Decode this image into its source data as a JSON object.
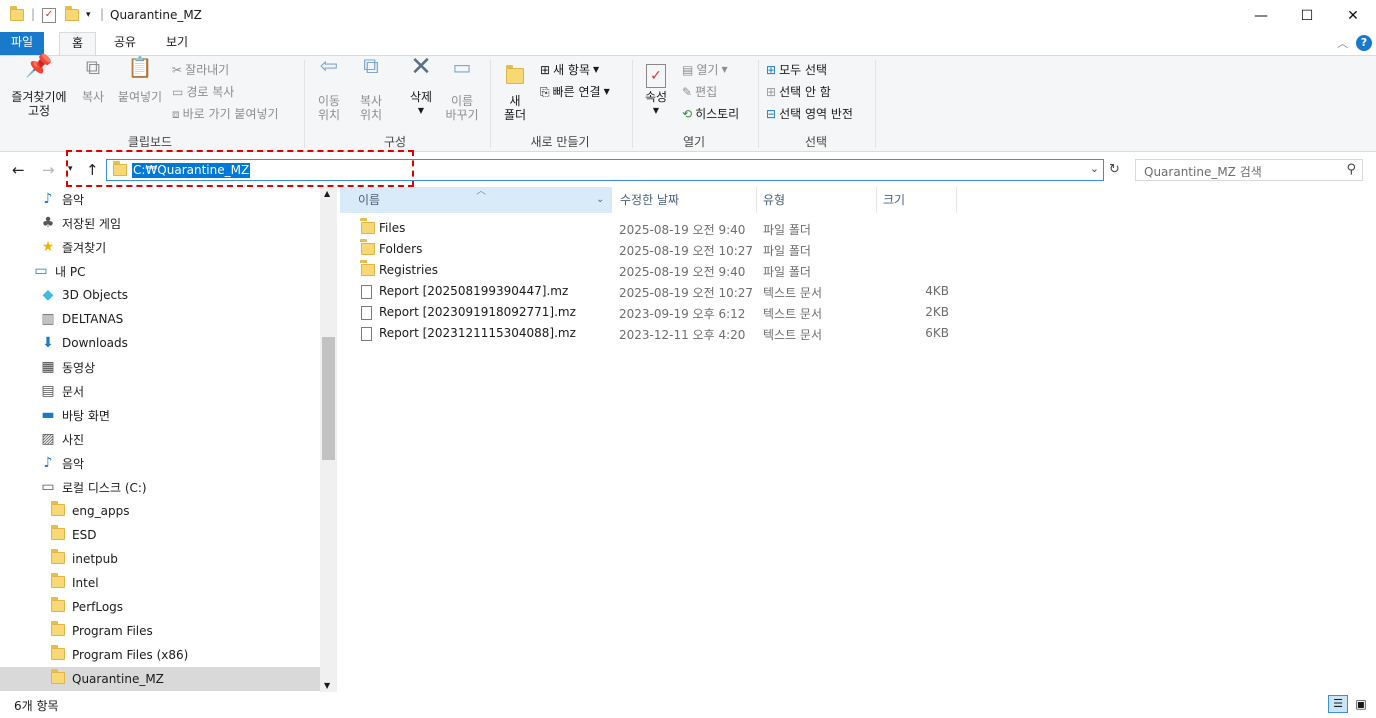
{
  "window": {
    "title": "Quarantine_MZ"
  },
  "ribbon_tabs": [
    "파일",
    "홈",
    "공유",
    "보기"
  ],
  "ribbon": {
    "clipboard": {
      "pin": "즐겨찾기에\n고정",
      "copy": "복사",
      "paste": "붙여넣기",
      "cut": "잘라내기",
      "copy_path": "경로 복사",
      "paste_shortcut": "바로 가기 붙여넣기",
      "label": "클립보드"
    },
    "organize": {
      "move": "이동\n위치",
      "copyto": "복사\n위치",
      "delete": "삭제",
      "rename": "이름\n바꾸기",
      "label": "구성"
    },
    "new": {
      "new_folder": "새\n폴더",
      "new_item": "새 항목",
      "easy_access": "빠른 연결",
      "label": "새로 만들기"
    },
    "open": {
      "properties": "속성",
      "open": "열기",
      "edit": "편집",
      "history": "히스토리",
      "label": "열기"
    },
    "select": {
      "select_all": "모두 선택",
      "select_none": "선택 안 함",
      "invert": "선택 영역 반전",
      "label": "선택"
    }
  },
  "address": {
    "path": "C:₩Quarantine_MZ",
    "search_placeholder": "Quarantine_MZ 검색"
  },
  "nav_items": [
    {
      "label": "음악",
      "icon": "music-icon",
      "indent": 1
    },
    {
      "label": "저장된 게임",
      "icon": "saved-games-icon",
      "indent": 1
    },
    {
      "label": "즐겨찾기",
      "icon": "star-icon",
      "indent": 1
    },
    {
      "label": "내 PC",
      "icon": "pc-icon",
      "indent": 0
    },
    {
      "label": "3D Objects",
      "icon": "3d-objects-icon",
      "indent": 1
    },
    {
      "label": "DELTANAS",
      "icon": "network-drive-icon",
      "indent": 1
    },
    {
      "label": "Downloads",
      "icon": "download-icon",
      "indent": 1
    },
    {
      "label": "동영상",
      "icon": "video-icon",
      "indent": 1
    },
    {
      "label": "문서",
      "icon": "document-icon",
      "indent": 1
    },
    {
      "label": "바탕 화면",
      "icon": "desktop-icon",
      "indent": 1
    },
    {
      "label": "사진",
      "icon": "pictures-icon",
      "indent": 1
    },
    {
      "label": "음악",
      "icon": "music-icon",
      "indent": 1
    },
    {
      "label": "로컬 디스크 (C:)",
      "icon": "drive-icon",
      "indent": 1
    },
    {
      "label": "eng_apps",
      "icon": "folder-icon",
      "indent": 2
    },
    {
      "label": "ESD",
      "icon": "folder-icon",
      "indent": 2
    },
    {
      "label": "inetpub",
      "icon": "folder-icon",
      "indent": 2
    },
    {
      "label": "Intel",
      "icon": "folder-icon",
      "indent": 2
    },
    {
      "label": "PerfLogs",
      "icon": "folder-icon",
      "indent": 2
    },
    {
      "label": "Program Files",
      "icon": "folder-icon",
      "indent": 2
    },
    {
      "label": "Program Files (x86)",
      "icon": "folder-icon",
      "indent": 2
    },
    {
      "label": "Quarantine_MZ",
      "icon": "folder-icon",
      "indent": 2,
      "selected": true
    }
  ],
  "columns": [
    "이름",
    "수정한 날짜",
    "유형",
    "크기"
  ],
  "files": [
    {
      "name": "Files",
      "date": "2025-08-19 오전 9:40",
      "type": "파일 폴더",
      "size": "",
      "kind": "folder"
    },
    {
      "name": "Folders",
      "date": "2025-08-19 오전 10:27",
      "type": "파일 폴더",
      "size": "",
      "kind": "folder"
    },
    {
      "name": "Registries",
      "date": "2025-08-19 오전 9:40",
      "type": "파일 폴더",
      "size": "",
      "kind": "folder"
    },
    {
      "name": "Report [202508199390447].mz",
      "date": "2025-08-19 오전 10:27",
      "type": "텍스트 문서",
      "size": "4KB",
      "kind": "doc"
    },
    {
      "name": "Report [2023091918092771].mz",
      "date": "2023-09-19 오후 6:12",
      "type": "텍스트 문서",
      "size": "2KB",
      "kind": "doc"
    },
    {
      "name": "Report [2023121115304088].mz",
      "date": "2023-12-11 오후 4:20",
      "type": "텍스트 문서",
      "size": "6KB",
      "kind": "doc"
    }
  ],
  "status": {
    "count": "6개 항목"
  },
  "colors": {
    "accent": "#1979ca",
    "selection": "#0078d7",
    "highlight_box": "#e00000"
  }
}
